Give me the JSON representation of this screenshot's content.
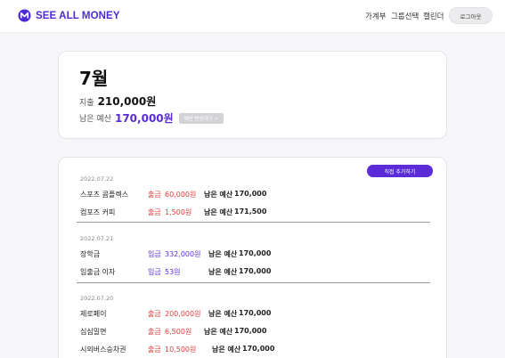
{
  "header": {
    "brand": "SEE ALL MONEY",
    "nav": [
      "가계부",
      "그룹선택",
      "캘린더"
    ],
    "logout_label": "로그아웃",
    "accent": "#4d2ad6"
  },
  "summary": {
    "month": "7월",
    "spend_label": "지출",
    "spend_value": "210,000원",
    "remain_label": "남은 예산",
    "remain_value": "170,000원",
    "change_button": "예산 변경하기 >"
  },
  "list": {
    "add_button": "직접 추가하기",
    "groups": [
      {
        "date": "2022.07.22",
        "items": [
          {
            "name": "스포츠 콤플렉스",
            "kind": "출금",
            "amount": "60,000원",
            "balance_label": "남은 예산",
            "balance": "170,000"
          },
          {
            "name": "컴포즈 커피",
            "kind": "출금",
            "amount": "1,500원",
            "balance_label": "남은 예산",
            "balance": "171,500"
          }
        ]
      },
      {
        "date": "2022.07.21",
        "items": [
          {
            "name": "장학금",
            "kind": "입금",
            "amount": "332,000원",
            "balance_label": "남은 예산",
            "balance": "170,000"
          },
          {
            "name": "입출금 이자",
            "kind": "입금",
            "amount": "53원",
            "balance_label": "남은 예산",
            "balance": "170,000"
          }
        ]
      },
      {
        "date": "2022.07.20",
        "items": [
          {
            "name": "제로페이",
            "kind": "출금",
            "amount": "200,000원",
            "balance_label": "남은 예산",
            "balance": "170,000"
          },
          {
            "name": "심심밀면",
            "kind": "출금",
            "amount": "6,500원",
            "balance_label": "남은 예산",
            "balance": "170,000"
          },
          {
            "name": "시외버스승차권",
            "kind": "출금",
            "amount": "10,500원",
            "balance_label": "남은 예산",
            "balance": "170,000"
          }
        ]
      }
    ]
  }
}
